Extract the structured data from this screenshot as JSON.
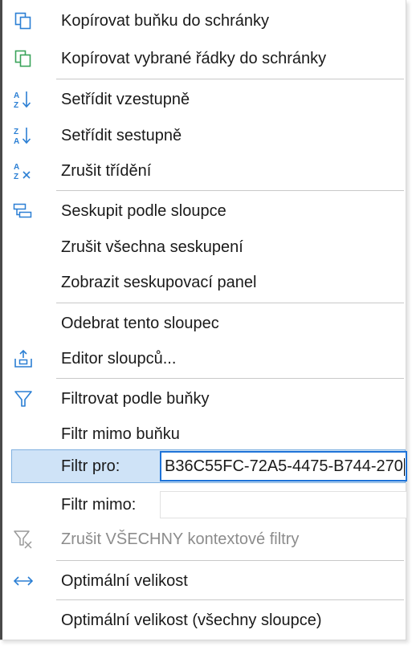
{
  "menu": {
    "items": [
      {
        "label": "Kopírovat buňku do schránky",
        "icon": "copy-cell-icon"
      },
      {
        "label": "Kopírovat vybrané řádky do schránky",
        "icon": "copy-rows-icon"
      },
      {
        "label": "Setřídit vzestupně",
        "icon": "sort-ascending-icon"
      },
      {
        "label": "Setřídit sestupně",
        "icon": "sort-descending-icon"
      },
      {
        "label": "Zrušit třídění",
        "icon": "clear-sort-icon"
      },
      {
        "label": "Seskupit podle sloupce",
        "icon": "group-by-column-icon"
      },
      {
        "label": "Zrušit všechna seskupení",
        "icon": ""
      },
      {
        "label": "Zobrazit seskupovací panel",
        "icon": ""
      },
      {
        "label": "Odebrat tento sloupec",
        "icon": ""
      },
      {
        "label": "Editor sloupců...",
        "icon": "column-editor-icon"
      },
      {
        "label": "Filtrovat podle buňky",
        "icon": "filter-icon"
      },
      {
        "label": "Filtr mimo buňku",
        "icon": ""
      },
      {
        "label": "Zrušit VŠECHNY kontextové filtry",
        "icon": "clear-filters-icon",
        "disabled": true
      },
      {
        "label": "Optimální velikost",
        "icon": "resize-horizontal-icon"
      },
      {
        "label": "Optimální velikost (všechny sloupce)",
        "icon": ""
      }
    ],
    "filter_for": {
      "label": "Filtr pro:",
      "value": "B36C55FC-72A5-4475-B744-270"
    },
    "filter_except": {
      "label": "Filtr mimo:",
      "value": ""
    }
  },
  "colors": {
    "icon_blue": "#2b7fd4",
    "icon_green": "#3aa35a",
    "highlight_bg": "#cfe3f7",
    "highlight_border": "#7fb0e0",
    "focus_border": "#1e73d8",
    "disabled_text": "#8c8c8c"
  }
}
